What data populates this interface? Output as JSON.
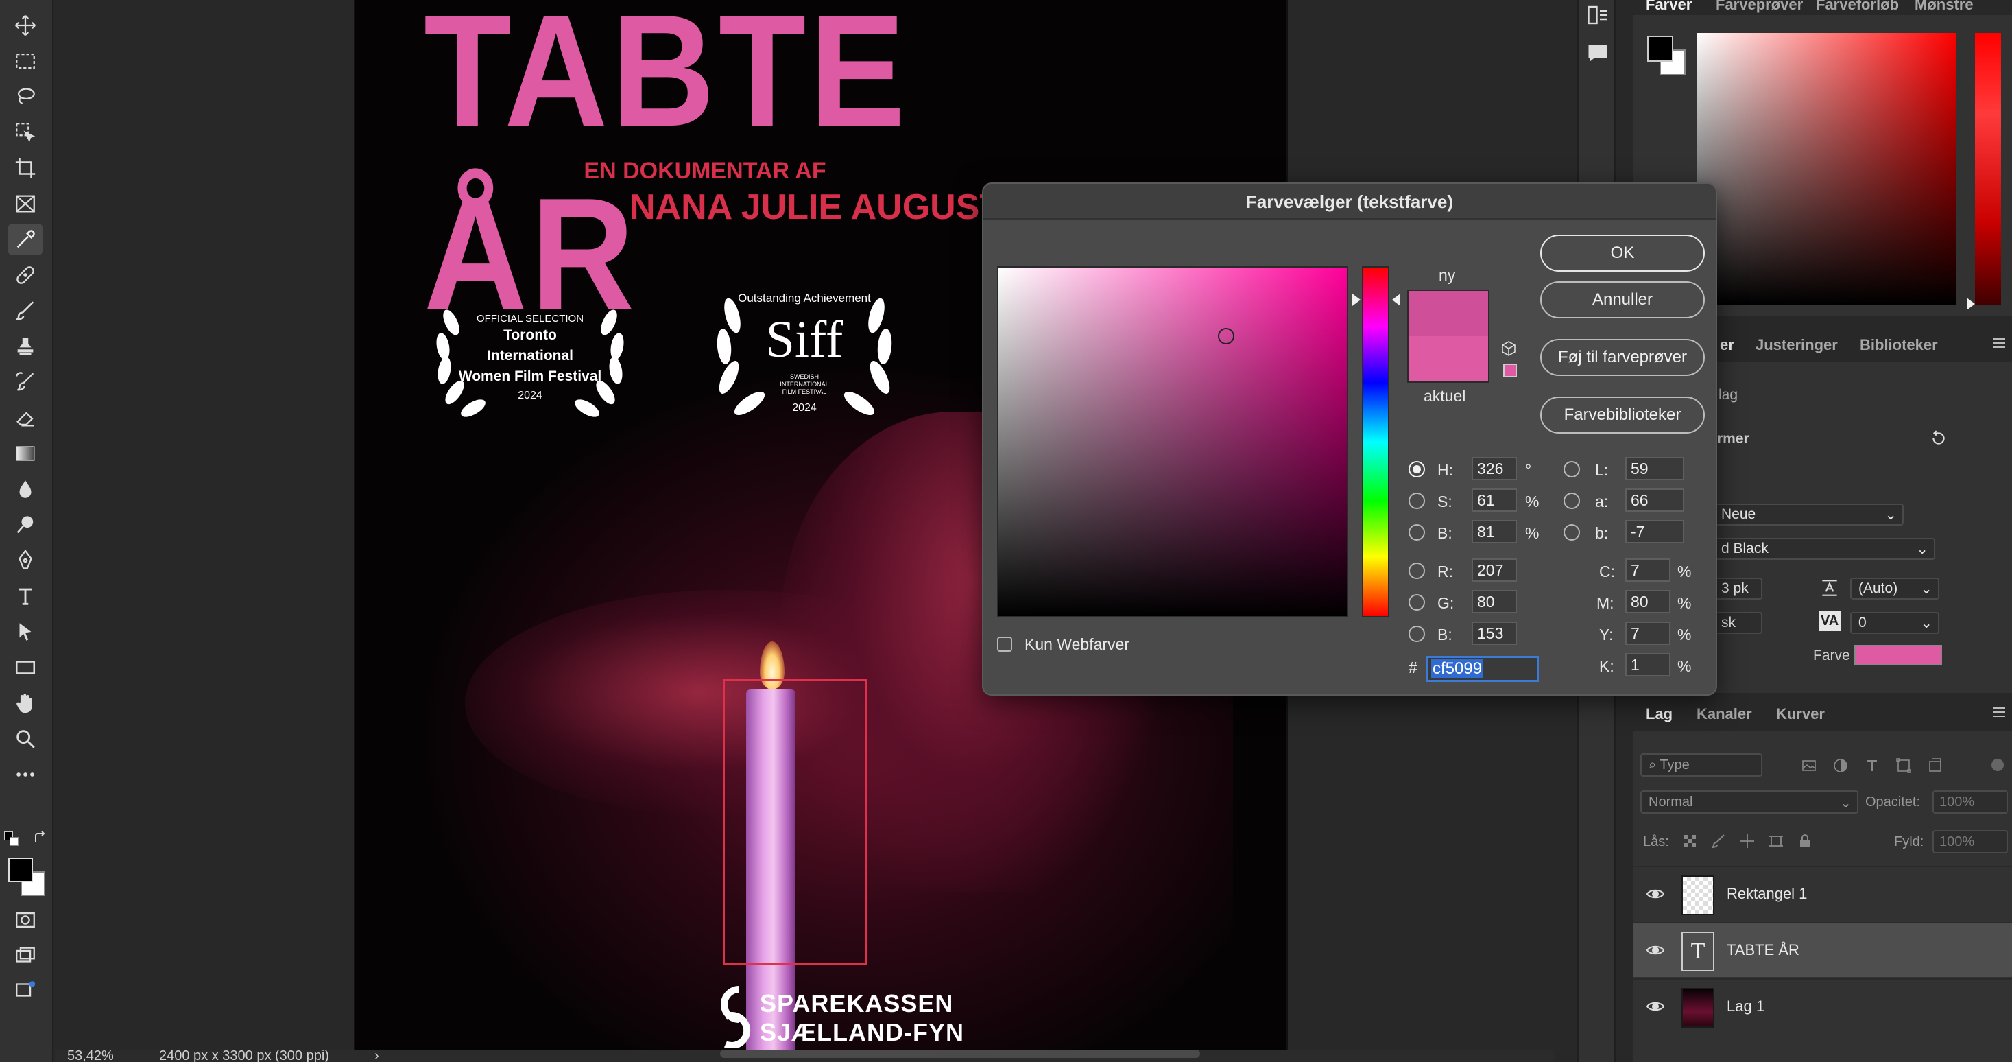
{
  "document": {
    "title_text": "TABTE ÅR",
    "subtitle1": "EN DOKUMENTAR AF",
    "subtitle2": "NANA JULIE AUGUSTIN",
    "laurel1": {
      "line1": "OFFICIAL SELECTION",
      "line2": "Toronto",
      "line3": "International",
      "line4": "Women Film Festival",
      "year": "2024"
    },
    "laurel2": {
      "line1": "Outstanding Achievement",
      "logo": "Siff",
      "small": "SWEDISH INTERNATIONAL FILM FESTIVAL",
      "year": "2024"
    },
    "sponsor_line1": "SPAREKASSEN",
    "sponsor_line2": "SJÆLLAND-FYN"
  },
  "statusbar": {
    "zoom": "53,42%",
    "doc_size": "2400 px x 3300 px (300 ppi)"
  },
  "toolbar": {
    "tools": [
      "move-icon",
      "marquee-icon",
      "lasso-icon",
      "object-select-icon",
      "crop-icon",
      "frame-icon",
      "eyedropper-icon",
      "healing-icon",
      "brush-icon",
      "stamp-icon",
      "history-brush-icon",
      "eraser-icon",
      "gradient-icon",
      "blur-icon",
      "dodge-icon",
      "pen-icon",
      "type-icon",
      "path-select-icon",
      "rectangle-icon",
      "hand-icon",
      "zoom-icon",
      "more-icon"
    ],
    "active_tool": "eyedropper-icon"
  },
  "color_panel": {
    "tabs": [
      "Farver",
      "Farveprøver",
      "Farveforløb",
      "Mønstre"
    ],
    "active_tab": "Farver"
  },
  "char_panel": {
    "tabs": [
      "er",
      "Justeringer",
      "Biblioteker"
    ],
    "section_label": "lag",
    "section_header": "rmer",
    "font_family": "Neue",
    "font_style": "d Black",
    "font_size": "3 pk",
    "leading": "(Auto)",
    "language": "sk",
    "tracking": "0",
    "color_label": "Farve",
    "color_value": "#de5ba3"
  },
  "layers_panel": {
    "tabs": [
      "Lag",
      "Kanaler",
      "Kurver"
    ],
    "active_tab": "Lag",
    "filter_placeholder": "Type",
    "blend_mode": "Normal",
    "opacity_label": "Opacitet:",
    "opacity_value": "100%",
    "lock_label": "Lås:",
    "fill_label": "Fyld:",
    "fill_value": "100%",
    "layers": [
      {
        "name": "Rektangel 1",
        "type": "shape",
        "visible": true,
        "selected": false
      },
      {
        "name": "TABTE ÅR",
        "type": "text",
        "visible": true,
        "selected": true
      },
      {
        "name": "Lag 1",
        "type": "image",
        "visible": true,
        "selected": false
      }
    ]
  },
  "dialog": {
    "title": "Farvevælger (tekstfarve)",
    "new_label": "ny",
    "current_label": "aktuel",
    "new_color": "#cf5099",
    "current_color": "#de5ba3",
    "buttons": {
      "ok": "OK",
      "cancel": "Annuller",
      "add_swatch": "Føj til farveprøver",
      "libraries": "Farvebiblioteker"
    },
    "web_only_label": "Kun Webfarver",
    "hsb": {
      "h_label": "H:",
      "h": "326",
      "h_unit": "°",
      "s_label": "S:",
      "s": "61",
      "s_unit": "%",
      "b_label": "B:",
      "b": "81",
      "b_unit": "%"
    },
    "rgb": {
      "r_label": "R:",
      "r": "207",
      "g_label": "G:",
      "g": "80",
      "b_label": "B:",
      "b": "153"
    },
    "lab": {
      "l_label": "L:",
      "l": "59",
      "a_label": "a:",
      "a": "66",
      "b_label": "b:",
      "b": "-7"
    },
    "cmyk": {
      "c_label": "C:",
      "c": "7",
      "m_label": "M:",
      "m": "80",
      "y_label": "Y:",
      "y": "7",
      "k_label": "K:",
      "k": "1",
      "unit": "%"
    },
    "hex_prefix": "#",
    "hex": "cf5099",
    "selected_mode": "H"
  }
}
